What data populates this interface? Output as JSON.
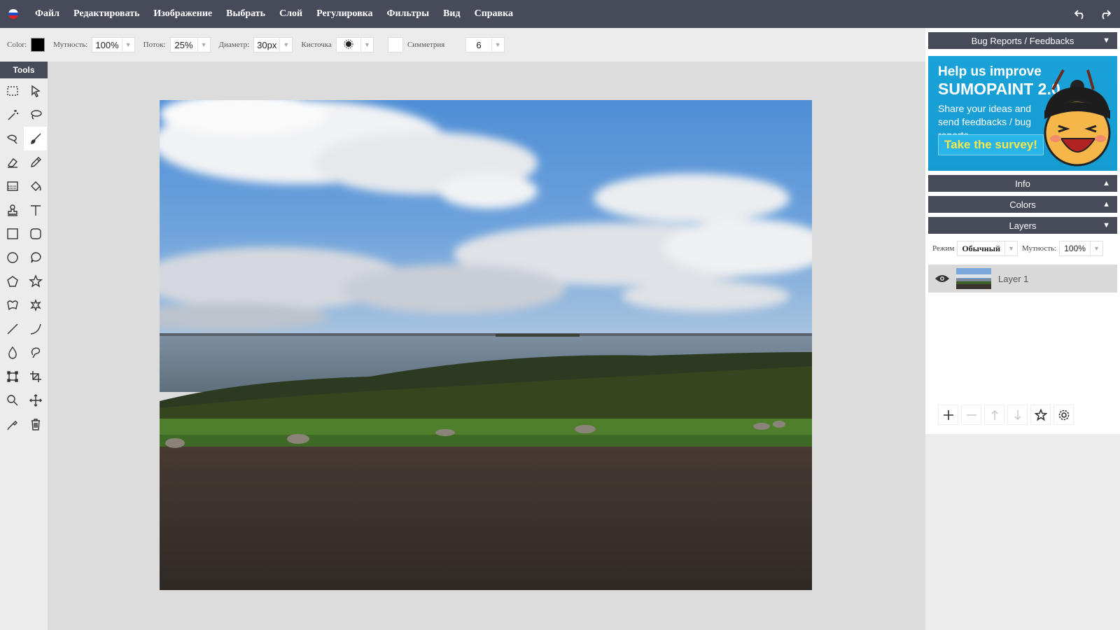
{
  "menubar": {
    "flag_colors": [
      "#ffffff",
      "#1c50c8",
      "#e02020"
    ],
    "items": [
      "Файл",
      "Редактировать",
      "Изображение",
      "Выбрать",
      "Слой",
      "Регулировка",
      "Фильтры",
      "Вид",
      "Справка"
    ],
    "undo_icon": "undo-icon",
    "redo_icon": "redo-icon"
  },
  "options": {
    "color_label": "Color:",
    "color_value": "#000000",
    "opacity_label": "Мутность:",
    "opacity_value": "100%",
    "flow_label": "Поток:",
    "flow_value": "25%",
    "diameter_label": "Диаметр:",
    "diameter_value": "30px",
    "brush_label": "Кисточка",
    "symmetry_label": "Симметрия",
    "symmetry_value": "6"
  },
  "tools": {
    "title": "Tools",
    "items": [
      "rect-select-icon",
      "arrow-select-icon",
      "magic-wand-icon",
      "lasso-icon",
      "brush-lasso-icon",
      "brush-icon",
      "eraser-icon",
      "pencil-icon",
      "gradient-icon",
      "paint-bucket-icon",
      "clone-stamp-icon",
      "text-icon",
      "rectangle-icon",
      "rounded-rectangle-icon",
      "ellipse-icon",
      "speech-bubble-icon",
      "pentagon-icon",
      "star-icon",
      "freeform-shape-icon",
      "burst-icon",
      "line-icon",
      "curve-icon",
      "blur-drop-icon",
      "smudge-icon",
      "transform-icon",
      "crop-icon",
      "zoom-icon",
      "move-icon",
      "eyedropper-icon",
      "trash-icon"
    ],
    "active": "brush-icon"
  },
  "right_panel": {
    "bug_reports": "Bug Reports / Feedbacks",
    "banner": {
      "line1": "Help us improve",
      "line2": "SUMOPAINT 2.0",
      "line3": "Share your ideas and send feedbacks / bug reports",
      "cta": "Take the survey!"
    },
    "info": "Info",
    "colors": "Colors",
    "layers": "Layers",
    "mode_label": "Режим",
    "mode_value": "Обычный",
    "opacity_label": "Мутность:",
    "opacity_value": "100%",
    "layer_name": "Layer 1"
  }
}
